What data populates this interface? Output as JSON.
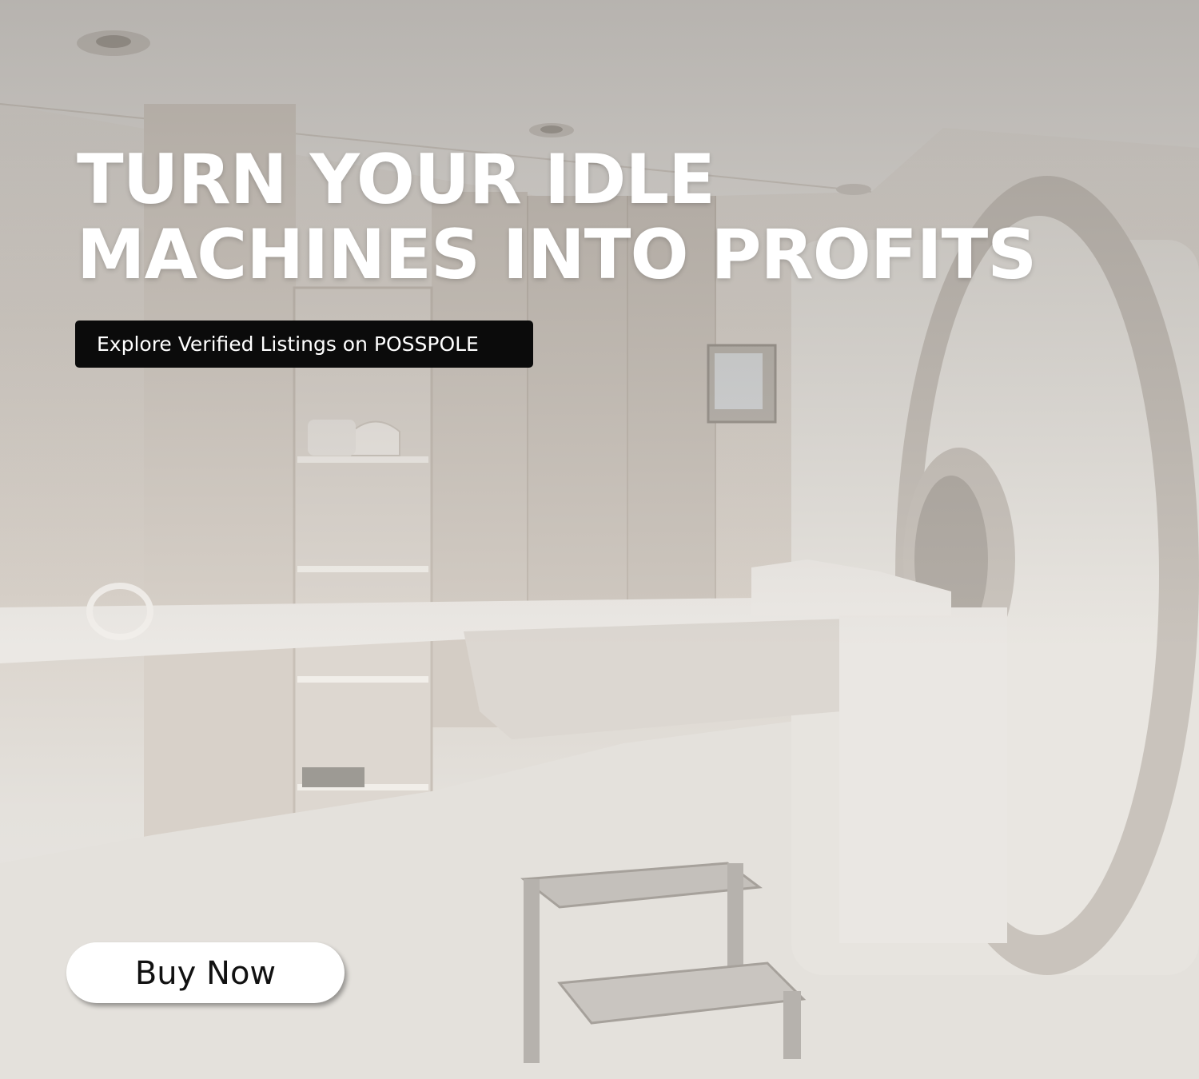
{
  "headline": {
    "line1": "TURN YOUR IDLE",
    "line2": "MACHINES INTO PROFITS"
  },
  "tagline": "Explore Verified Listings on POSSPOLE",
  "cta": {
    "label": "Buy Now"
  },
  "colors": {
    "headline_text": "#ffffff",
    "tag_background": "#0b0b0b",
    "button_background": "#ffffff",
    "button_text": "#111111"
  }
}
